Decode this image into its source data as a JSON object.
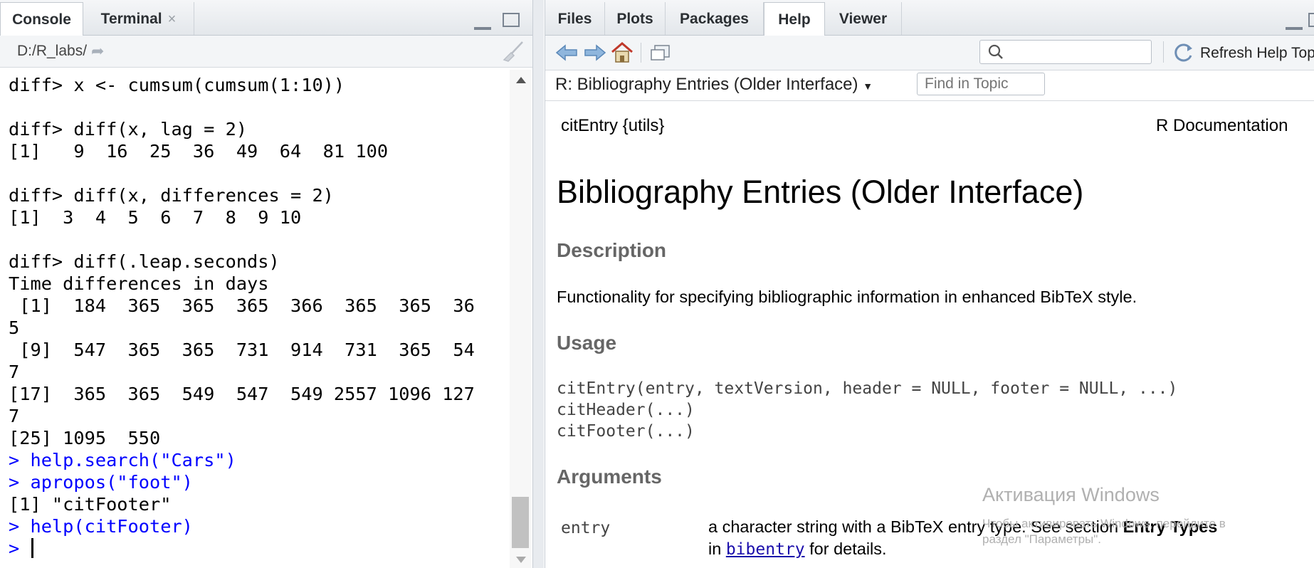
{
  "left_pane": {
    "tabs": [
      {
        "label": "Console"
      },
      {
        "label": "Terminal"
      }
    ],
    "tab_close_glyph": "×",
    "path": "D:/R_labs/",
    "console_lines": [
      {
        "text": "diff> x <- cumsum(cumsum(1:10))",
        "color": "black"
      },
      {
        "text": "",
        "color": "black"
      },
      {
        "text": "diff> diff(x, lag = 2)",
        "color": "black"
      },
      {
        "text": "[1]   9  16  25  36  49  64  81 100",
        "color": "black"
      },
      {
        "text": "",
        "color": "black"
      },
      {
        "text": "diff> diff(x, differences = 2)",
        "color": "black"
      },
      {
        "text": "[1]  3  4  5  6  7  8  9 10",
        "color": "black"
      },
      {
        "text": "",
        "color": "black"
      },
      {
        "text": "diff> diff(.leap.seconds)",
        "color": "black"
      },
      {
        "text": "Time differences in days",
        "color": "black"
      },
      {
        "text": " [1]  184  365  365  365  366  365  365  36",
        "color": "black"
      },
      {
        "text": "5",
        "color": "black"
      },
      {
        "text": " [9]  547  365  365  731  914  731  365  54",
        "color": "black"
      },
      {
        "text": "7",
        "color": "black"
      },
      {
        "text": "[17]  365  365  549  547  549 2557 1096 127",
        "color": "black"
      },
      {
        "text": "7",
        "color": "black"
      },
      {
        "text": "[25] 1095  550",
        "color": "black"
      },
      {
        "text": "> help.search(\"Cars\")",
        "color": "blue"
      },
      {
        "text": "> apropos(\"foot\")",
        "color": "blue"
      },
      {
        "text": "[1] \"citFooter\"",
        "color": "black"
      },
      {
        "text": "> help(citFooter)",
        "color": "blue"
      }
    ],
    "prompt": "> "
  },
  "right_pane": {
    "tabs": [
      {
        "label": "Files"
      },
      {
        "label": "Plots"
      },
      {
        "label": "Packages"
      },
      {
        "label": "Help"
      },
      {
        "label": "Viewer"
      }
    ],
    "toolbar": {
      "back_icon": "back-arrow-icon",
      "forward_icon": "forward-arrow-icon",
      "home_icon": "home-icon",
      "popout_icon": "show-in-new-window-icon",
      "search_placeholder": "",
      "refresh_label": "Refresh Help Top"
    },
    "topic_title": "R: Bibliography Entries (Older Interface)",
    "find_placeholder": "Find in Topic",
    "doc": {
      "header_left": "citEntry {utils}",
      "header_right": "R Documentation",
      "title": "Bibliography Entries (Older Interface)",
      "description_heading": "Description",
      "description_text": "Functionality for specifying bibliographic information in enhanced BibTeX style.",
      "usage_heading": "Usage",
      "usage_code": "citEntry(entry, textVersion, header = NULL, footer = NULL, ...)\ncitHeader(...)\ncitFooter(...)",
      "arguments_heading": "Arguments",
      "arg_entry_name": "entry",
      "arg_entry_desc_1": "a character string with a BibTeX entry type. See section ",
      "arg_entry_desc_bold": "Entry Types",
      "arg_entry_desc_2": "in ",
      "arg_entry_link": "bibentry",
      "arg_entry_desc_3": " for details."
    }
  },
  "watermark": {
    "line1": "Активация Windows",
    "line2": "Чтобы активировать Windows, перейдите в",
    "line3": "раздел \"Параметры\"."
  },
  "colors": {
    "console_blue": "#0000ff",
    "link": "#1a0dab",
    "heading_gray": "#666666"
  }
}
